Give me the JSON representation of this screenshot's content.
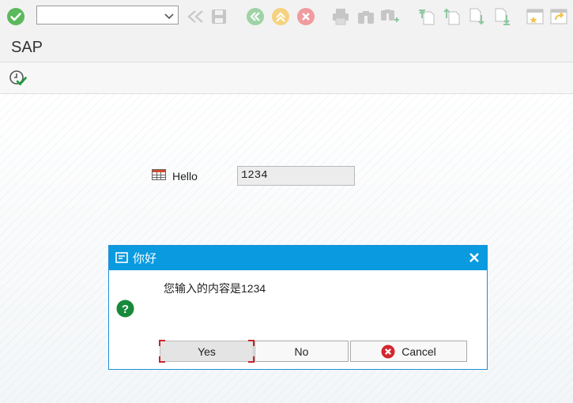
{
  "toolbar": {
    "command_field": {
      "value": "",
      "placeholder": ""
    },
    "icons": [
      "enter-icon",
      "back-icon",
      "save-icon",
      "back-green-icon",
      "exit-icon",
      "cancel-icon",
      "print-icon",
      "find-icon",
      "find-next-icon",
      "first-page-icon",
      "previous-page-icon",
      "next-page-icon",
      "last-page-icon",
      "new-session-icon",
      "shortcut-icon"
    ]
  },
  "title_bar": {
    "title": "SAP"
  },
  "app_toolbar": {
    "icons": [
      "execute-icon"
    ]
  },
  "main": {
    "field_label": "Hello",
    "field_value": "1234"
  },
  "dialog": {
    "title": "你好",
    "message": "您输入的内容是1234",
    "buttons": {
      "yes": "Yes",
      "no": "No",
      "cancel": "Cancel"
    }
  },
  "colors": {
    "dialog_header": "#0a9ae0",
    "enter_green": "#5cb85c",
    "question_green": "#168a3a",
    "cancel_red": "#d3262e"
  }
}
